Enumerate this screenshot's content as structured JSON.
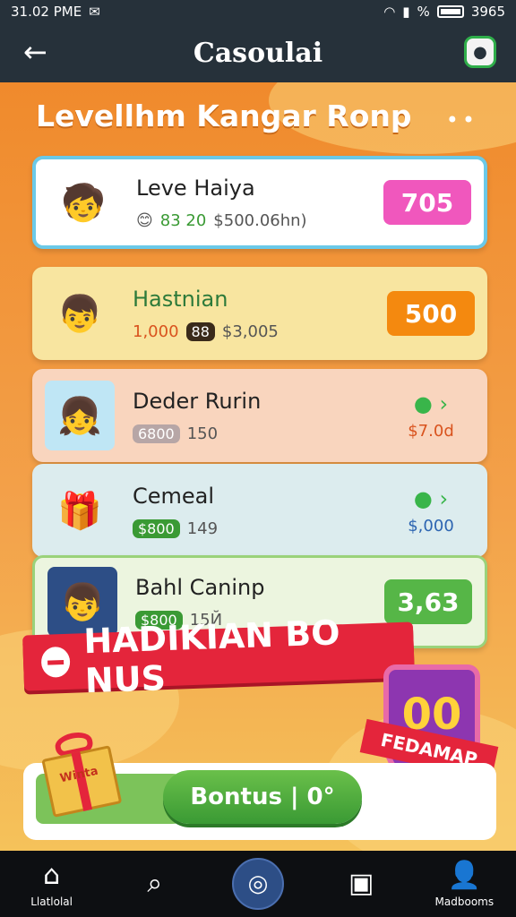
{
  "status": {
    "time": "31.02 PME",
    "percent": "%",
    "right_value": "3965"
  },
  "app_bar": {
    "title": "Casoulai",
    "back_icon": "arrow-left-icon",
    "account_icon": "badge-icon"
  },
  "page": {
    "heading": "Levellhm Kangar Ronp",
    "more_label": "••"
  },
  "cards": [
    {
      "name": "Leve Haiya",
      "stat_a": "83 20",
      "stat_b": "$500.06hn)",
      "reward": "705",
      "color": "#f057bd"
    },
    {
      "name": "Hastnian",
      "stat_a": "1,000",
      "pill": "88",
      "stat_b": "$3,005",
      "reward": "500",
      "color": "#f4890f"
    },
    {
      "name": "Deder Rurin",
      "pill": "6800",
      "stat_b": "150",
      "reward": "$7.0d",
      "color": "#d9531e"
    },
    {
      "name": "Cemeal",
      "pill": "$800",
      "stat_b": "149",
      "reward": "$,000",
      "color": "#2c64b1"
    },
    {
      "name": "Bahl Caninp",
      "pill": "$800",
      "stat_b": "15Й",
      "reward": "3,63",
      "color": "#56b647"
    }
  ],
  "banner": {
    "text": "HADIKIAN BO NUS"
  },
  "shield": {
    "number": "00",
    "ribbon": "FEDAMAP"
  },
  "bottom": {
    "bonus_label": "Bontus | 0°",
    "gift_text": "Winta"
  },
  "nav": [
    {
      "label": "Llatlolal",
      "icon": "home-icon"
    },
    {
      "label": "",
      "icon": "search-icon"
    },
    {
      "label": "",
      "icon": "chat-icon"
    },
    {
      "label": "",
      "icon": "box-icon"
    },
    {
      "label": "Madbooms",
      "icon": "person-icon"
    }
  ]
}
